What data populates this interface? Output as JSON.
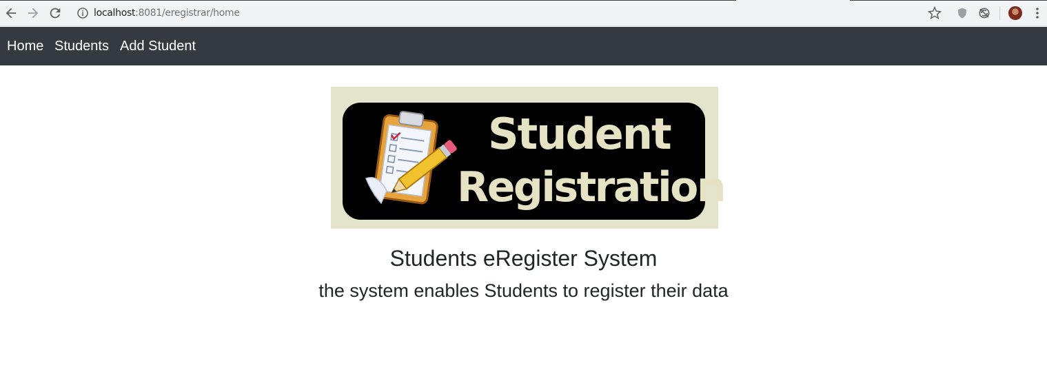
{
  "browser": {
    "url_host": "localhost",
    "url_path": ":8081/eregistrar/home",
    "icons": {
      "back": "arrow-left-icon",
      "forward": "arrow-right-icon",
      "reload": "reload-icon",
      "site_info": "info-icon",
      "bookmark": "star-icon",
      "extension_1": "shield-icon",
      "extension_2": "sync-icon",
      "profile": "avatar",
      "menu": "kebab-menu-icon"
    }
  },
  "navbar": {
    "background": "#343a40",
    "items": [
      {
        "label": "Home"
      },
      {
        "label": "Students"
      },
      {
        "label": "Add Student"
      }
    ]
  },
  "banner": {
    "line1": "Student",
    "line2": "Registration",
    "image": "clipboard-pencil-illustration"
  },
  "main": {
    "title": "Students eRegister System",
    "subtitle": "the system enables Students to register their data"
  }
}
